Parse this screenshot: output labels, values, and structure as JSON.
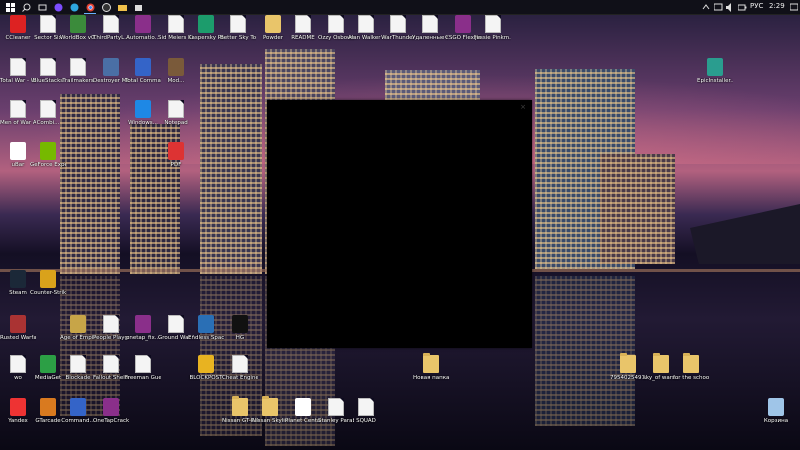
{
  "taskbar": {
    "apps": [
      "start-icon",
      "search-icon",
      "task-view-icon",
      "app-icon",
      "browser-icon",
      "chrome-icon",
      "obs-icon",
      "file-explorer-icon",
      "store-icon"
    ],
    "tray": {
      "lang": "РУС",
      "time": "2:29"
    }
  },
  "desktop": {
    "icons": [
      {
        "label": "CCleaner",
        "icon": "ccleaner-icon",
        "kind": "exe",
        "color": "#d22"
      },
      {
        "label": "Sector Six",
        "icon": "doc-icon",
        "kind": "doc"
      },
      {
        "label": "WorldBox v0.5.148",
        "icon": "worldbox-icon",
        "kind": "exe",
        "color": "#3b8b3b"
      },
      {
        "label": "ThirdPartyL...",
        "icon": "doc-icon",
        "kind": "doc"
      },
      {
        "label": "Automatio...",
        "icon": "winrar-icon",
        "kind": "exe",
        "color": "#8a2f8a"
      },
      {
        "label": "Sid Meiers Civilization...",
        "icon": "doc-icon",
        "kind": "doc"
      },
      {
        "label": "Kaspersky Password...",
        "icon": "kaspersky-icon",
        "kind": "exe",
        "color": "#1c9c6c"
      },
      {
        "label": "Better Sky Tou...",
        "icon": "doc-icon",
        "kind": "doc"
      },
      {
        "label": "Powder",
        "icon": "powder-icon",
        "kind": "exe",
        "color": "#e9c56a"
      },
      {
        "label": "README",
        "icon": "doc-icon",
        "kind": "doc"
      },
      {
        "label": "Ozzy Osbourne",
        "icon": "doc-icon",
        "kind": "doc"
      },
      {
        "label": "Alan Walker - Hope | Ne...",
        "icon": "html-icon",
        "kind": "doc"
      },
      {
        "label": "WarThunder",
        "icon": "doc-icon",
        "kind": "doc"
      },
      {
        "label": "Удаленные приложения",
        "icon": "html-icon",
        "kind": "doc"
      },
      {
        "label": "CSGO FlexHaz...",
        "icon": "winrar-icon",
        "kind": "exe",
        "color": "#8a2f8a"
      },
      {
        "label": "Jessie Pinkm...",
        "icon": "doc-icon",
        "kind": "doc"
      },
      {
        "label": "Total War - WARHAM...",
        "icon": "doc-icon",
        "kind": "doc"
      },
      {
        "label": "BlueStacks",
        "icon": "doc-icon",
        "kind": "doc"
      },
      {
        "label": "Trailmakers",
        "icon": "doc-icon",
        "kind": "doc"
      },
      {
        "label": "Destroyer Mobile",
        "icon": "destroyer-icon",
        "kind": "exe",
        "color": "#4a6fa5"
      },
      {
        "label": "Total Commander",
        "icon": "floppy-icon",
        "kind": "exe",
        "color": "#3464c8"
      },
      {
        "label": "Mod...",
        "icon": "mod-icon",
        "kind": "exe",
        "color": "#7a5a3a"
      },
      {
        "label": "Men of War Assault Sq...",
        "icon": "doc-icon",
        "kind": "doc"
      },
      {
        "label": "Combi...",
        "icon": "doc-icon",
        "kind": "doc"
      },
      {
        "label": "Windows...",
        "icon": "windows-icon",
        "kind": "exe",
        "color": "#1e88e5"
      },
      {
        "label": "Notepad",
        "icon": "doc-icon",
        "kind": "doc"
      },
      {
        "label": "uBar",
        "icon": "ubar-icon",
        "kind": "exe",
        "color": "#fff"
      },
      {
        "label": "GeForce Experience",
        "icon": "nvidia-icon",
        "kind": "exe",
        "color": "#76b900"
      },
      {
        "label": "PDF",
        "icon": "pdf-icon",
        "kind": "exe",
        "color": "#d33"
      },
      {
        "label": "EpicInstaller...",
        "icon": "epic-installer-icon",
        "kind": "exe",
        "color": "#2a9d8f"
      },
      {
        "label": "Steam",
        "icon": "steam-icon",
        "kind": "exe",
        "color": "#1b2838"
      },
      {
        "label": "Counter-Strike Global...",
        "icon": "csgo-icon",
        "kind": "exe",
        "color": "#d9a21b"
      },
      {
        "label": "Rusted Warfare",
        "icon": "rusted-warfare-icon",
        "kind": "exe",
        "color": "#a33"
      },
      {
        "label": "Age of Empires II",
        "icon": "aoe-icon",
        "kind": "exe",
        "color": "#c7a548"
      },
      {
        "label": "People Playground",
        "icon": "doc-icon",
        "kind": "doc"
      },
      {
        "label": "onetap_fix...",
        "icon": "winrar-icon",
        "kind": "exe",
        "color": "#8a2f8a"
      },
      {
        "label": "Ground War Tanks",
        "icon": "doc-icon",
        "kind": "doc"
      },
      {
        "label": "Endless Space 2",
        "icon": "endless-space-icon",
        "kind": "exe",
        "color": "#2a6fb5"
      },
      {
        "label": "HG",
        "icon": "hg-icon",
        "kind": "exe",
        "color": "#111"
      },
      {
        "label": "wo",
        "icon": "doc-icon",
        "kind": "doc"
      },
      {
        "label": "MediaGet",
        "icon": "mediaget-icon",
        "kind": "exe",
        "color": "#2c9f45"
      },
      {
        "label": "Blockade",
        "icon": "doc-icon",
        "kind": "doc"
      },
      {
        "label": "Fallout Shelter",
        "icon": "doc-icon",
        "kind": "doc"
      },
      {
        "label": "Freeman Guerril...",
        "icon": "doc-icon",
        "kind": "doc"
      },
      {
        "label": "BLOCKPOST",
        "icon": "blockpost-icon",
        "kind": "exe",
        "color": "#e8b321"
      },
      {
        "label": "Cheat Engine 2019",
        "icon": "doc-icon",
        "kind": "doc"
      },
      {
        "label": "Новая папка",
        "icon": "folder-icon",
        "kind": "folder"
      },
      {
        "label": "7954025497...",
        "icon": "folder-icon",
        "kind": "folder"
      },
      {
        "label": "sky_of wars...",
        "icon": "folder-icon",
        "kind": "folder"
      },
      {
        "label": "for the school2",
        "icon": "folder-icon",
        "kind": "folder"
      },
      {
        "label": "Yandex",
        "icon": "yandex-icon",
        "kind": "exe",
        "color": "#e33"
      },
      {
        "label": "GTarcade",
        "icon": "gtarcade-icon",
        "kind": "exe",
        "color": "#d97a1f"
      },
      {
        "label": "Command...",
        "icon": "floppy-icon",
        "kind": "exe",
        "color": "#3464c8"
      },
      {
        "label": "OneTapCrack",
        "icon": "winrar-icon",
        "kind": "exe",
        "color": "#8a2f8a"
      },
      {
        "label": "Nissan GT-R Реставрат...",
        "icon": "folder-icon",
        "kind": "folder"
      },
      {
        "label": "Nissan Skyline GT-R",
        "icon": "folder-icon",
        "kind": "folder"
      },
      {
        "label": "Planet Centauri",
        "icon": "planet-icon",
        "kind": "exe",
        "color": "#fff"
      },
      {
        "label": "Stanley Parable",
        "icon": "doc-icon",
        "kind": "doc"
      },
      {
        "label": "SQUAD",
        "icon": "doc-icon",
        "kind": "doc"
      },
      {
        "label": "Корзина",
        "icon": "recycle-bin-icon",
        "kind": "exe",
        "color": "#9fc5e8"
      }
    ]
  },
  "window": {
    "close_glyph": "×"
  }
}
